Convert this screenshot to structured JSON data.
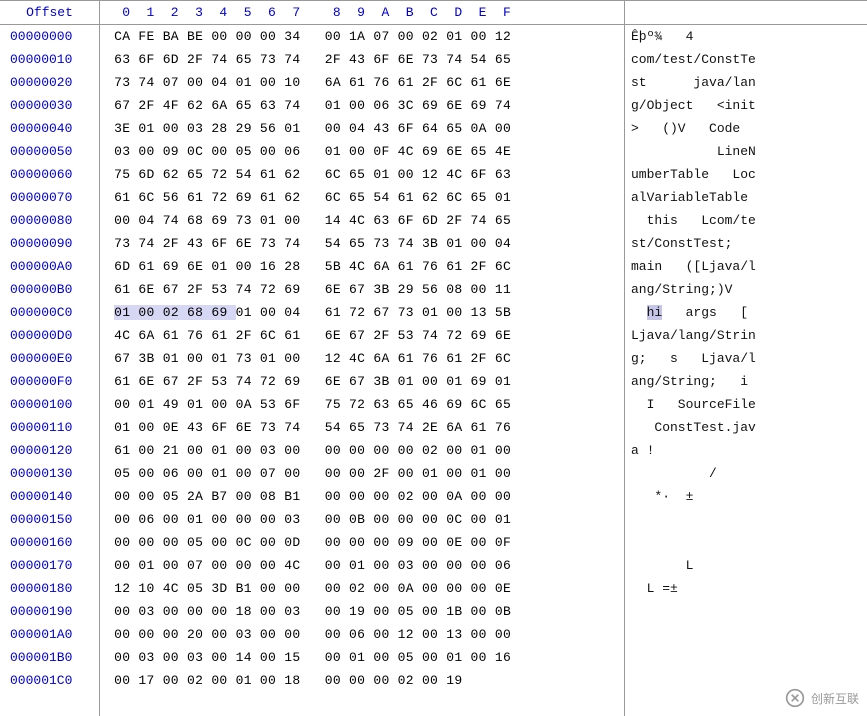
{
  "labels": {
    "offset_header": "Offset",
    "watermark": "创新互联"
  },
  "highlight": {
    "row": 12,
    "hex_from": 0,
    "hex_to": 5,
    "ascii_from": 2,
    "ascii_to": 4
  },
  "columns": [
    "0",
    "1",
    "2",
    "3",
    "4",
    "5",
    "6",
    "7",
    "8",
    "9",
    "A",
    "B",
    "C",
    "D",
    "E",
    "F"
  ],
  "rows": [
    {
      "off": "00000000",
      "hex": [
        "CA",
        "FE",
        "BA",
        "BE",
        "00",
        "00",
        "00",
        "34",
        "00",
        "1A",
        "07",
        "00",
        "02",
        "01",
        "00",
        "12"
      ],
      "asc": "Êþº¾   4        "
    },
    {
      "off": "00000010",
      "hex": [
        "63",
        "6F",
        "6D",
        "2F",
        "74",
        "65",
        "73",
        "74",
        "2F",
        "43",
        "6F",
        "6E",
        "73",
        "74",
        "54",
        "65"
      ],
      "asc": "com/test/ConstTe"
    },
    {
      "off": "00000020",
      "hex": [
        "73",
        "74",
        "07",
        "00",
        "04",
        "01",
        "00",
        "10",
        "6A",
        "61",
        "76",
        "61",
        "2F",
        "6C",
        "61",
        "6E"
      ],
      "asc": "st      java/lan"
    },
    {
      "off": "00000030",
      "hex": [
        "67",
        "2F",
        "4F",
        "62",
        "6A",
        "65",
        "63",
        "74",
        "01",
        "00",
        "06",
        "3C",
        "69",
        "6E",
        "69",
        "74"
      ],
      "asc": "g/Object   <init"
    },
    {
      "off": "00000040",
      "hex": [
        "3E",
        "01",
        "00",
        "03",
        "28",
        "29",
        "56",
        "01",
        "00",
        "04",
        "43",
        "6F",
        "64",
        "65",
        "0A",
        "00"
      ],
      "asc": ">   ()V   Code  "
    },
    {
      "off": "00000050",
      "hex": [
        "03",
        "00",
        "09",
        "0C",
        "00",
        "05",
        "00",
        "06",
        "01",
        "00",
        "0F",
        "4C",
        "69",
        "6E",
        "65",
        "4E"
      ],
      "asc": "           LineN"
    },
    {
      "off": "00000060",
      "hex": [
        "75",
        "6D",
        "62",
        "65",
        "72",
        "54",
        "61",
        "62",
        "6C",
        "65",
        "01",
        "00",
        "12",
        "4C",
        "6F",
        "63"
      ],
      "asc": "umberTable   Loc"
    },
    {
      "off": "00000070",
      "hex": [
        "61",
        "6C",
        "56",
        "61",
        "72",
        "69",
        "61",
        "62",
        "6C",
        "65",
        "54",
        "61",
        "62",
        "6C",
        "65",
        "01"
      ],
      "asc": "alVariableTable "
    },
    {
      "off": "00000080",
      "hex": [
        "00",
        "04",
        "74",
        "68",
        "69",
        "73",
        "01",
        "00",
        "14",
        "4C",
        "63",
        "6F",
        "6D",
        "2F",
        "74",
        "65"
      ],
      "asc": "  this   Lcom/te"
    },
    {
      "off": "00000090",
      "hex": [
        "73",
        "74",
        "2F",
        "43",
        "6F",
        "6E",
        "73",
        "74",
        "54",
        "65",
        "73",
        "74",
        "3B",
        "01",
        "00",
        "04"
      ],
      "asc": "st/ConstTest;   "
    },
    {
      "off": "000000A0",
      "hex": [
        "6D",
        "61",
        "69",
        "6E",
        "01",
        "00",
        "16",
        "28",
        "5B",
        "4C",
        "6A",
        "61",
        "76",
        "61",
        "2F",
        "6C"
      ],
      "asc": "main   ([Ljava/l"
    },
    {
      "off": "000000B0",
      "hex": [
        "61",
        "6E",
        "67",
        "2F",
        "53",
        "74",
        "72",
        "69",
        "6E",
        "67",
        "3B",
        "29",
        "56",
        "08",
        "00",
        "11"
      ],
      "asc": "ang/String;)V   "
    },
    {
      "off": "000000C0",
      "hex": [
        "01",
        "00",
        "02",
        "68",
        "69",
        "01",
        "00",
        "04",
        "61",
        "72",
        "67",
        "73",
        "01",
        "00",
        "13",
        "5B"
      ],
      "asc": "  hi   args   ["
    },
    {
      "off": "000000D0",
      "hex": [
        "4C",
        "6A",
        "61",
        "76",
        "61",
        "2F",
        "6C",
        "61",
        "6E",
        "67",
        "2F",
        "53",
        "74",
        "72",
        "69",
        "6E"
      ],
      "asc": "Ljava/lang/Strin"
    },
    {
      "off": "000000E0",
      "hex": [
        "67",
        "3B",
        "01",
        "00",
        "01",
        "73",
        "01",
        "00",
        "12",
        "4C",
        "6A",
        "61",
        "76",
        "61",
        "2F",
        "6C"
      ],
      "asc": "g;   s   Ljava/l"
    },
    {
      "off": "000000F0",
      "hex": [
        "61",
        "6E",
        "67",
        "2F",
        "53",
        "74",
        "72",
        "69",
        "6E",
        "67",
        "3B",
        "01",
        "00",
        "01",
        "69",
        "01"
      ],
      "asc": "ang/String;   i "
    },
    {
      "off": "00000100",
      "hex": [
        "00",
        "01",
        "49",
        "01",
        "00",
        "0A",
        "53",
        "6F",
        "75",
        "72",
        "63",
        "65",
        "46",
        "69",
        "6C",
        "65"
      ],
      "asc": "  I   SourceFile"
    },
    {
      "off": "00000110",
      "hex": [
        "01",
        "00",
        "0E",
        "43",
        "6F",
        "6E",
        "73",
        "74",
        "54",
        "65",
        "73",
        "74",
        "2E",
        "6A",
        "61",
        "76"
      ],
      "asc": "   ConstTest.jav"
    },
    {
      "off": "00000120",
      "hex": [
        "61",
        "00",
        "21",
        "00",
        "01",
        "00",
        "03",
        "00",
        "00",
        "00",
        "00",
        "00",
        "02",
        "00",
        "01",
        "00"
      ],
      "asc": "a !             "
    },
    {
      "off": "00000130",
      "hex": [
        "05",
        "00",
        "06",
        "00",
        "01",
        "00",
        "07",
        "00",
        "00",
        "00",
        "2F",
        "00",
        "01",
        "00",
        "01",
        "00"
      ],
      "asc": "          /     "
    },
    {
      "off": "00000140",
      "hex": [
        "00",
        "00",
        "05",
        "2A",
        "B7",
        "00",
        "08",
        "B1",
        "00",
        "00",
        "00",
        "02",
        "00",
        "0A",
        "00",
        "00"
      ],
      "asc": "   *·  ±        "
    },
    {
      "off": "00000150",
      "hex": [
        "00",
        "06",
        "00",
        "01",
        "00",
        "00",
        "00",
        "03",
        "00",
        "0B",
        "00",
        "00",
        "00",
        "0C",
        "00",
        "01"
      ],
      "asc": "                "
    },
    {
      "off": "00000160",
      "hex": [
        "00",
        "00",
        "00",
        "05",
        "00",
        "0C",
        "00",
        "0D",
        "00",
        "00",
        "00",
        "09",
        "00",
        "0E",
        "00",
        "0F"
      ],
      "asc": "                "
    },
    {
      "off": "00000170",
      "hex": [
        "00",
        "01",
        "00",
        "07",
        "00",
        "00",
        "00",
        "4C",
        "00",
        "01",
        "00",
        "03",
        "00",
        "00",
        "00",
        "06"
      ],
      "asc": "       L        "
    },
    {
      "off": "00000180",
      "hex": [
        "12",
        "10",
        "4C",
        "05",
        "3D",
        "B1",
        "00",
        "00",
        "00",
        "02",
        "00",
        "0A",
        "00",
        "00",
        "00",
        "0E"
      ],
      "asc": "  L =±          "
    },
    {
      "off": "00000190",
      "hex": [
        "00",
        "03",
        "00",
        "00",
        "00",
        "18",
        "00",
        "03",
        "00",
        "19",
        "00",
        "05",
        "00",
        "1B",
        "00",
        "0B"
      ],
      "asc": "                "
    },
    {
      "off": "000001A0",
      "hex": [
        "00",
        "00",
        "00",
        "20",
        "00",
        "03",
        "00",
        "00",
        "00",
        "06",
        "00",
        "12",
        "00",
        "13",
        "00",
        "00"
      ],
      "asc": "                "
    },
    {
      "off": "000001B0",
      "hex": [
        "00",
        "03",
        "00",
        "03",
        "00",
        "14",
        "00",
        "15",
        "00",
        "01",
        "00",
        "05",
        "00",
        "01",
        "00",
        "16"
      ],
      "asc": "                "
    },
    {
      "off": "000001C0",
      "hex": [
        "00",
        "17",
        "00",
        "02",
        "00",
        "01",
        "00",
        "18",
        "00",
        "00",
        "00",
        "02",
        "00",
        "19"
      ],
      "asc": "              "
    }
  ]
}
